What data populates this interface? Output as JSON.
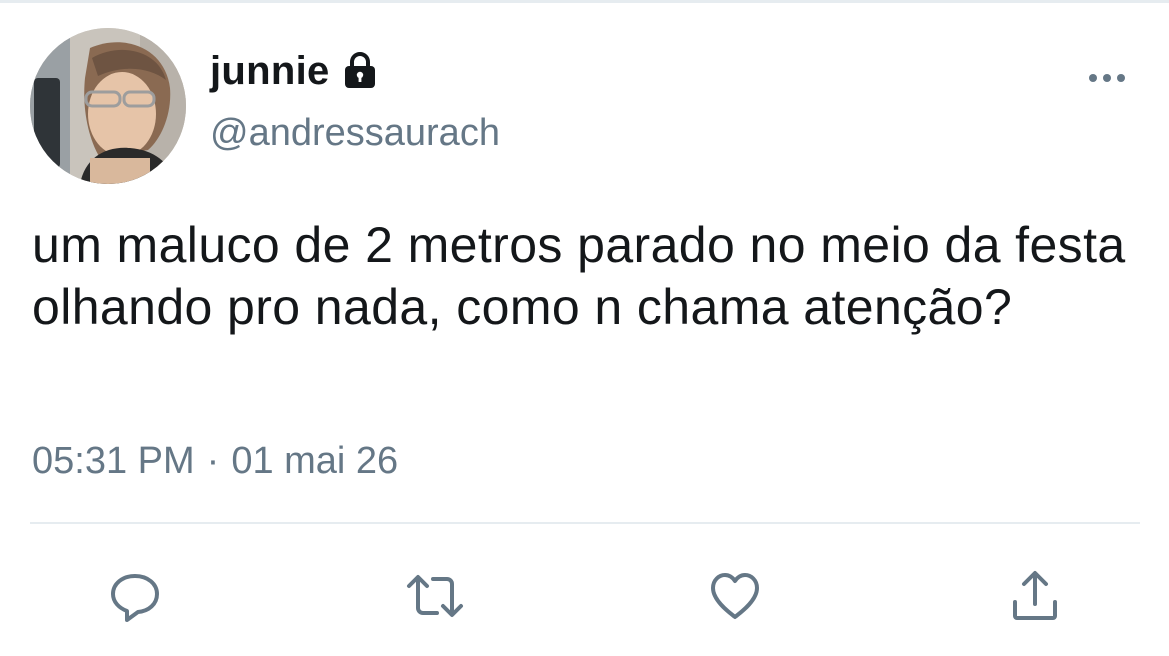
{
  "tweet": {
    "author": {
      "display_name": "junnie",
      "handle": "@andressaurach",
      "protected_icon": "lock-icon",
      "avatar": "avatar-photo"
    },
    "more_icon": "more-horizontal-icon",
    "text": "um maluco de 2 metros parado no meio da festa olhando pro nada, como n chama atenção?",
    "time": "05:31 PM",
    "separator": "·",
    "date": "01 mai 26",
    "actions": {
      "reply_icon": "reply-icon",
      "retweet_icon": "retweet-icon",
      "like_icon": "heart-icon",
      "share_icon": "share-icon"
    },
    "colors": {
      "primary_text": "#14171a",
      "secondary_text": "#657786",
      "icon": "#657786",
      "divider": "#e6ecf0"
    }
  }
}
